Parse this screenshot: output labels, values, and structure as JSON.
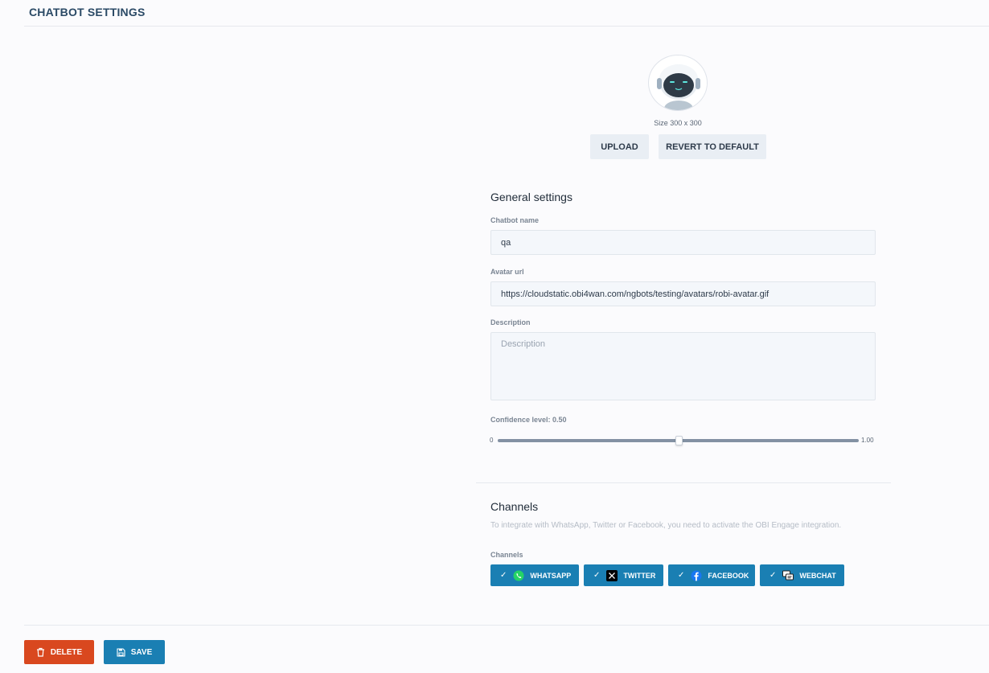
{
  "header": {
    "title": "CHATBOT SETTINGS"
  },
  "avatar": {
    "size_text": "Size 300 x 300",
    "upload_label": "UPLOAD",
    "revert_label": "REVERT TO DEFAULT"
  },
  "general": {
    "title": "General settings",
    "name_label": "Chatbot name",
    "name_value": "qa",
    "avatar_url_label": "Avatar url",
    "avatar_url_value": "https://cloudstatic.obi4wan.com/ngbots/testing/avatars/robi-avatar.gif",
    "description_label": "Description",
    "description_placeholder": "Description",
    "description_value": "",
    "confidence_label": "Confidence level: 0.50",
    "confidence_value": 0.5,
    "confidence_min": "0",
    "confidence_max": "1.00"
  },
  "channels": {
    "title": "Channels",
    "note": "To integrate with WhatsApp, Twitter or Facebook, you need to activate the OBI Engage integration.",
    "label": "Channels",
    "items": [
      {
        "label": "WHATSAPP",
        "icon": "whatsapp-icon",
        "selected": true
      },
      {
        "label": "TWITTER",
        "icon": "x-twitter-icon",
        "selected": true
      },
      {
        "label": "FACEBOOK",
        "icon": "facebook-icon",
        "selected": true
      },
      {
        "label": "WEBCHAT",
        "icon": "webchat-icon",
        "selected": true
      }
    ]
  },
  "footer": {
    "delete_label": "DELETE",
    "save_label": "SAVE"
  },
  "colors": {
    "primary": "#1a7fb3",
    "danger": "#d9481f",
    "header_text": "#2b4a66",
    "light_button": "#e9eef4"
  }
}
